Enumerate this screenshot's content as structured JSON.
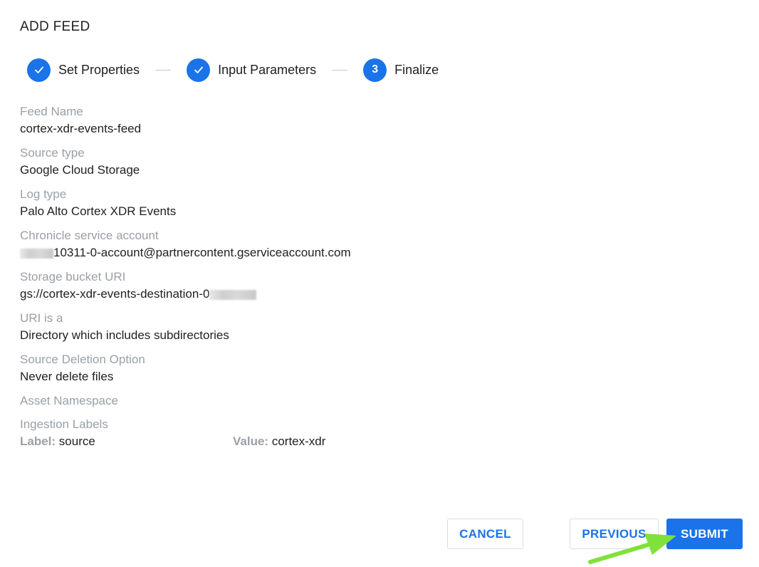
{
  "dialog": {
    "title": "ADD FEED"
  },
  "stepper": {
    "steps": [
      {
        "label": "Set Properties",
        "status": "complete",
        "icon": "check-icon"
      },
      {
        "label": "Input Parameters",
        "status": "complete",
        "icon": "check-icon"
      },
      {
        "label": "Finalize",
        "status": "current",
        "number": "3"
      }
    ]
  },
  "fields": [
    {
      "label": "Feed Name",
      "value": "cortex-xdr-events-feed"
    },
    {
      "label": "Source type",
      "value": "Google Cloud Storage"
    },
    {
      "label": "Log type",
      "value": "Palo Alto Cortex XDR Events"
    },
    {
      "label": "Chronicle service account",
      "value": "10311-0-account@partnercontent.gserviceaccount.com"
    },
    {
      "label": "Storage bucket URI",
      "value": "gs://cortex-xdr-events-destination-0"
    },
    {
      "label": "URI is a",
      "value": "Directory which includes subdirectories"
    },
    {
      "label": "Source Deletion Option",
      "value": "Never delete files"
    },
    {
      "label": "Asset Namespace",
      "value": ""
    }
  ],
  "ingestion_labels": {
    "heading": "Ingestion Labels",
    "label_key": "Label:",
    "label_value": "source",
    "value_key": "Value:",
    "value_value": "cortex-xdr"
  },
  "actions": {
    "cancel": "CANCEL",
    "previous": "PREVIOUS",
    "submit": "SUBMIT"
  },
  "colors": {
    "accent": "#1a73e8",
    "muted_text": "#9aa0a6",
    "annotation_arrow": "#7ee23a"
  }
}
